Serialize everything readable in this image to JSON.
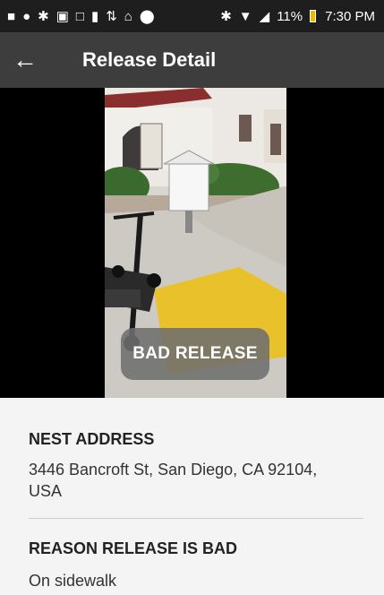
{
  "status_bar": {
    "left_icons": [
      "message-icon",
      "messenger-icon",
      "slack-icon",
      "image-icon",
      "screen-cast-icon",
      "sim-icon",
      "transfer-icon",
      "home-icon",
      "circle-icon"
    ],
    "right_icons": [
      "bluetooth-icon",
      "wifi-icon",
      "signal-icon"
    ],
    "battery_text": "11%",
    "time": "7:30 PM"
  },
  "app_bar": {
    "title": "Release Detail",
    "back_icon": "arrow-back-icon"
  },
  "photo": {
    "badge": "BAD RELEASE"
  },
  "details": {
    "nest_address_label": "NEST ADDRESS",
    "nest_address_value": "3446 Bancroft St, San Diego, CA 92104, USA",
    "reason_label": "REASON RELEASE IS BAD",
    "reason_value": "On sidewalk"
  },
  "colors": {
    "status_bar_bg": "#1e1e1e",
    "app_bar_bg": "#3d3d3d",
    "page_bg": "#f4f4f4",
    "battery": "#e9b800"
  }
}
